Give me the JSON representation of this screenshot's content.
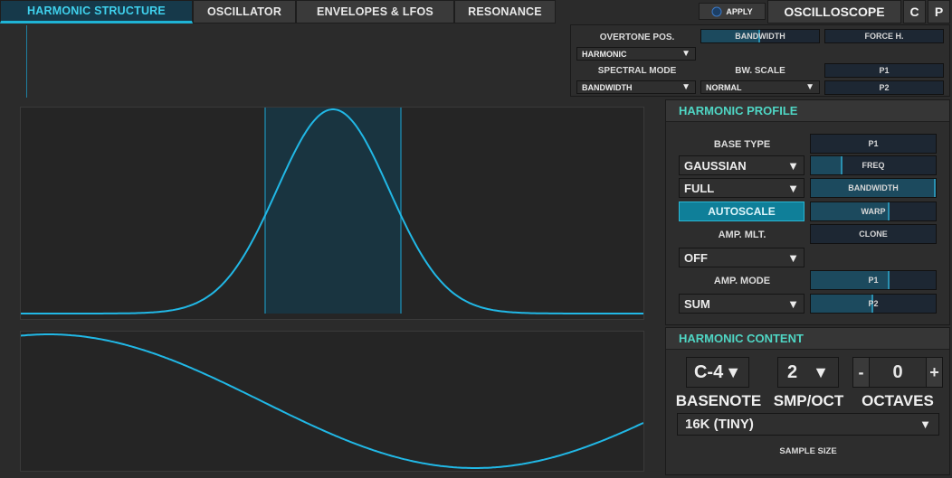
{
  "tabs": [
    {
      "label": "HARMONIC STRUCTURE",
      "active": true
    },
    {
      "label": "OSCILLATOR",
      "active": false
    },
    {
      "label": "ENVELOPES & LFOS",
      "active": false
    },
    {
      "label": "RESONANCE",
      "active": false
    }
  ],
  "toolbar": {
    "apply_label": "APPLY",
    "oscilloscope_label": "OSCILLOSCOPE",
    "c_label": "C",
    "p_label": "P"
  },
  "overtone": {
    "overtone_pos_label": "OVERTONE POS.",
    "overtone_pos_value": "HARMONIC",
    "spectral_mode_label": "SPECTRAL MODE",
    "spectral_mode_value": "BANDWIDTH",
    "bw_scale_label": "BW. SCALE",
    "bw_scale_value": "NORMAL",
    "bandwidth_label": "BANDWIDTH",
    "bandwidth_value": 0.5,
    "force_h_label": "FORCE H.",
    "p1_label": "P1",
    "p2_label": "P2"
  },
  "harmonic_profile": {
    "title": "HARMONIC PROFILE",
    "base_type_label": "BASE TYPE",
    "base_type_value": "GAUSSIAN",
    "full_value": "FULL",
    "autoscale_label": "AUTOSCALE",
    "amp_mlt_label": "AMP. MLT.",
    "amp_mlt_value": "OFF",
    "amp_mode_label": "AMP. MODE",
    "amp_mode_value": "SUM",
    "sliders": [
      {
        "label": "P1",
        "value": 0.0
      },
      {
        "label": "FREQ",
        "value": 0.25
      },
      {
        "label": "BANDWIDTH",
        "value": 1.0
      },
      {
        "label": "WARP",
        "value": 0.63
      },
      {
        "label": "CLONE",
        "value": 0.0
      },
      {
        "label": "P1",
        "value": 0.63
      },
      {
        "label": "P2",
        "value": 0.5
      }
    ]
  },
  "harmonic_content": {
    "title": "HARMONIC CONTENT",
    "basenote_value": "C-4",
    "basenote_label": "BASENOTE",
    "smp_oct_value": "2",
    "smp_oct_label": "SMP/OCT",
    "octaves_minus": "-",
    "octaves_value": "0",
    "octaves_plus": "+",
    "octaves_label": "OCTAVES",
    "sample_size_value": "16K (TINY)",
    "sample_size_label": "SAMPLE SIZE"
  },
  "icons": {
    "dropdown_arrow": "▼",
    "apply_icon": "power-icon"
  },
  "colors": {
    "accent": "#1fb4d6",
    "curve": "#21b8e6",
    "section_title": "#4fd6c4",
    "active_tab_text": "#3fd0ec"
  }
}
